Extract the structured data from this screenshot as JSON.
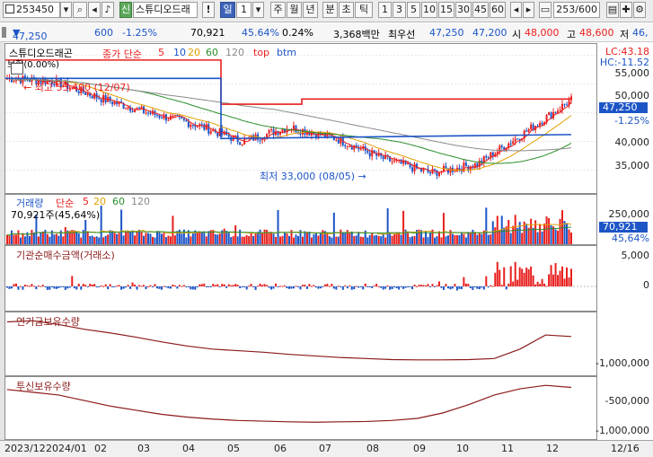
{
  "toolbar": {
    "code": "253450",
    "name": "스튜디오드래",
    "sin_label": "신",
    "period_selected": "일",
    "period_count": "1",
    "periods": [
      "주",
      "월",
      "년",
      "분",
      "초",
      "틱"
    ],
    "minutes": [
      "1",
      "3",
      "5",
      "10",
      "15",
      "30",
      "45",
      "60"
    ],
    "bar_count": "253",
    "bar_total": "/600"
  },
  "info": {
    "price": "47,250",
    "change": "600",
    "change_rate": "-1.25%",
    "volume": "70,921",
    "volume_rate": "45.64%",
    "turnover_rate": "0.24%",
    "amount": "3,368백만",
    "prio_label": "최우선",
    "prio_ask": "47,250",
    "prio_bid": "47,200",
    "open_label": "시",
    "open": "48,000",
    "high_label": "고",
    "high": "48,600",
    "low_label": "저",
    "low": "46,"
  },
  "price_panel": {
    "stock_name": "스튜디오드래곤",
    "change_text": "보합(0.00%)",
    "ma_label": "종가 단순",
    "ma_periods": [
      "5",
      "10",
      "20",
      "60",
      "120"
    ],
    "top_label": "top",
    "btm_label": "btm",
    "lc_text": "LC:43.18",
    "hc_text": "HC:-11.52",
    "high_mark": "최고 53,400 (12/07)",
    "low_mark": "최저 33,000 (08/05)",
    "y_labels": [
      "55,000",
      "50,000",
      "45,000",
      "40,000",
      "35,000"
    ],
    "current_price": "47,250",
    "current_change": "-1.25%"
  },
  "volume_panel": {
    "title": "거래량",
    "ma_label": "단순",
    "ma_periods": [
      "5",
      "20",
      "60",
      "120"
    ],
    "sub": "70,921주(45,64%)",
    "y_labels": [
      "250,000",
      "150,000"
    ],
    "current": "70,921",
    "current_pct": "45,64%"
  },
  "inst_panel": {
    "title": "기관순매수금액(거래소)",
    "y_labels": [
      "5,000",
      "0"
    ]
  },
  "pension_panel": {
    "title": "연기금보유수량",
    "y_labels": [
      "-1,000,000"
    ]
  },
  "trust_panel": {
    "title": "투신보유수량",
    "y_labels": [
      "-500,000",
      "-1,000,000"
    ]
  },
  "x_axis": {
    "labels": [
      "2023/12",
      "2024/01",
      "02",
      "03",
      "04",
      "05",
      "06",
      "07",
      "08",
      "09",
      "10",
      "11",
      "12",
      "12/16"
    ]
  },
  "colors": {
    "up": "#e8201e",
    "down": "#1d55c7",
    "ma5": "#e8201e",
    "ma10": "#1d55c7",
    "ma20": "#e0a000",
    "ma60": "#2a8f2a",
    "ma120": "#8a8a8a",
    "holding": "#8b1a1a"
  },
  "chart_data": [
    {
      "type": "line",
      "title": "",
      "series": [
        {
          "name": "",
          "x": [
            "2023/12",
            "2024/01",
            "2024/02",
            "2024/03",
            "2024/04",
            "2024/05",
            "2024/06",
            "2024/07",
            "2024/08",
            "2024/09",
            "2024/10",
            "2024/11",
            "2024/12"
          ],
          "values": [
            51000,
            50500,
            47500,
            45000,
            43000,
            40000,
            42500,
            40500,
            37000,
            34500,
            36000,
            41500,
            47250
          ]
        }
      ],
      "ylim": [
        31000,
        57000
      ],
      "high": {
        "date": "12/07",
        "value": 53400
      },
      "low": {
        "date": "08/05",
        "value": 33000
      }
    },
    {
      "type": "bar",
      "title": "",
      "ylim": [
        0,
        300000
      ],
      "latest": 70921
    },
    {
      "type": "bar",
      "title": "",
      "ylim": [
        -3000,
        7000
      ]
    },
    {
      "type": "line",
      "title": "",
      "ylim": [
        -1200000,
        0
      ]
    },
    {
      "type": "line",
      "title": "",
      "ylim": [
        -1200000,
        -300000
      ]
    }
  ]
}
